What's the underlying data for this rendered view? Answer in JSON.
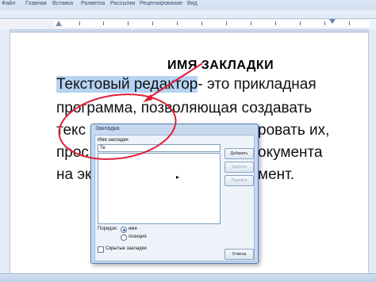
{
  "ribbon": {
    "tabs": [
      "Файл",
      "Главная",
      "Вставка",
      "Разметка",
      "Рассылки",
      "Рецензирование",
      "Вид"
    ]
  },
  "document": {
    "heading": "ИМЯ ЗАКЛАДКИ",
    "line1_highlight": "Текстовый редактор",
    "line1_rest": "- это прикладная",
    "line2": "программа, позволяющая создавать",
    "line3_left": "текс",
    "line3_right": "ровать их,",
    "line4_left": "прос",
    "line4_right": "окумента",
    "line5_left": "на эк",
    "line5_right": "мент."
  },
  "dialog": {
    "title": "Закладка",
    "name_label": "Имя закладки:",
    "name_value": "Те",
    "buttons": {
      "add": "Добавить",
      "delete": "Удалить",
      "goto": "Перейти",
      "cancel": "Отмена"
    },
    "sort_label": "Порядок:",
    "sort_options": {
      "name": "имя",
      "position": "позиция"
    },
    "hidden_label": "Скрытые закладки"
  },
  "colors": {
    "highlight": "#b5d3f2",
    "annotation": "#e0203a",
    "dialog_bg": "#c7d9ef"
  }
}
